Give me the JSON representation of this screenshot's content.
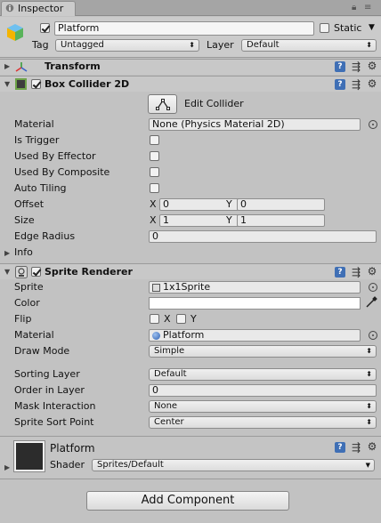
{
  "tab": {
    "title": "Inspector"
  },
  "header": {
    "name": "Platform",
    "active": true,
    "static_label": "Static",
    "static": false,
    "tag_label": "Tag",
    "tag_value": "Untagged",
    "layer_label": "Layer",
    "layer_value": "Default"
  },
  "transform": {
    "title": "Transform"
  },
  "box_collider": {
    "title": "Box Collider 2D",
    "enabled": true,
    "edit_collider_label": "Edit Collider",
    "material_label": "Material",
    "material_value": "None (Physics Material 2D)",
    "is_trigger_label": "Is Trigger",
    "used_by_effector_label": "Used By Effector",
    "used_by_composite_label": "Used By Composite",
    "auto_tiling_label": "Auto Tiling",
    "offset_label": "Offset",
    "offset": {
      "x_label": "X",
      "x": "0",
      "y_label": "Y",
      "y": "0"
    },
    "size_label": "Size",
    "size": {
      "x_label": "X",
      "x": "1",
      "y_label": "Y",
      "y": "1"
    },
    "edge_radius_label": "Edge Radius",
    "edge_radius": "0",
    "info_label": "Info"
  },
  "sprite_renderer": {
    "title": "Sprite Renderer",
    "enabled": true,
    "sprite_label": "Sprite",
    "sprite_value": "1x1Sprite",
    "color_label": "Color",
    "color_value": "#ffffff",
    "flip_label": "Flip",
    "flip_x_label": "X",
    "flip_y_label": "Y",
    "material_label": "Material",
    "material_value": "Platform",
    "draw_mode_label": "Draw Mode",
    "draw_mode_value": "Simple",
    "sorting_layer_label": "Sorting Layer",
    "sorting_layer_value": "Default",
    "order_in_layer_label": "Order in Layer",
    "order_in_layer_value": "0",
    "mask_interaction_label": "Mask Interaction",
    "mask_interaction_value": "None",
    "sprite_sort_point_label": "Sprite Sort Point",
    "sprite_sort_point_value": "Center"
  },
  "material_block": {
    "name": "Platform",
    "shader_label": "Shader",
    "shader_value": "Sprites/Default"
  },
  "add_component_label": "Add Component",
  "colors": {
    "background": "#c2c2c2",
    "help_icon": "#3f6fb5",
    "collider_green": "#6ea34a"
  }
}
